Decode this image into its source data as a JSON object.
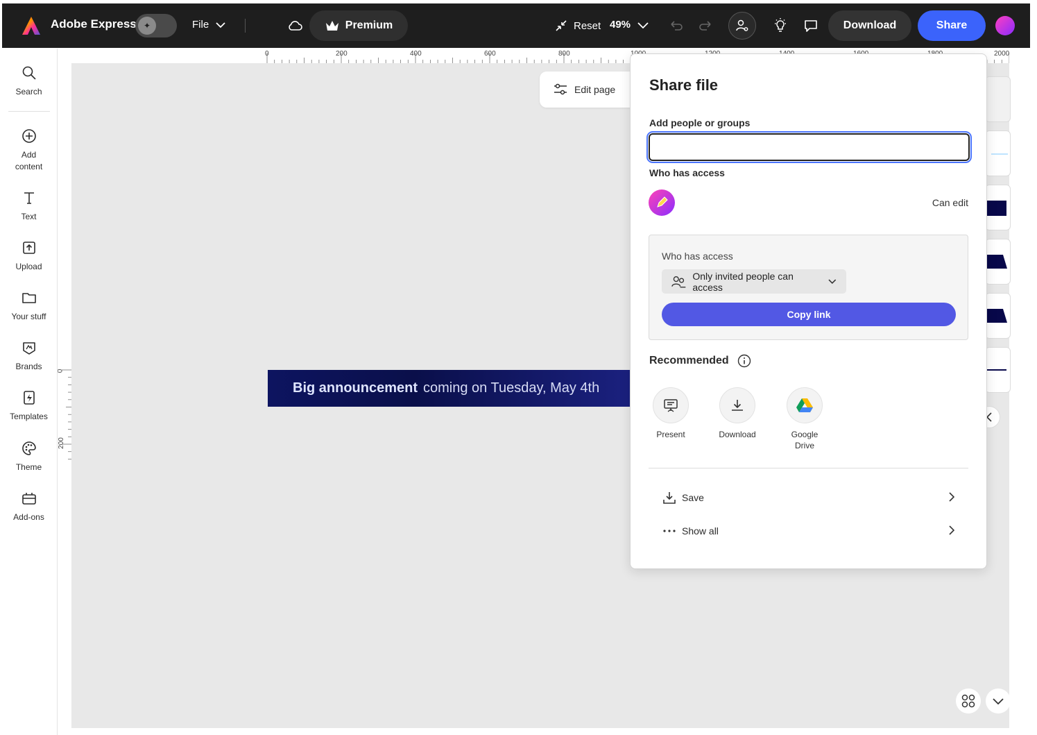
{
  "topbar": {
    "app_title": "Adobe Express",
    "file_label": "File",
    "premium_label": "Premium",
    "reset_label": "Reset",
    "zoom_value": "49%",
    "download_label": "Download",
    "share_label": "Share"
  },
  "sidebar": {
    "items": [
      {
        "label": "Search",
        "icon": "search-icon"
      },
      {
        "label": "Add\ncontent",
        "icon": "plus-circle-icon"
      },
      {
        "label": "Text",
        "icon": "text-icon"
      },
      {
        "label": "Upload",
        "icon": "upload-icon"
      },
      {
        "label": "Your stuff",
        "icon": "folder-icon"
      },
      {
        "label": "Brands",
        "icon": "brand-icon"
      },
      {
        "label": "Templates",
        "icon": "templates-icon"
      },
      {
        "label": "Theme",
        "icon": "palette-icon"
      },
      {
        "label": "Add-ons",
        "icon": "addons-icon"
      }
    ]
  },
  "rulers": {
    "top_ticks": [
      "0",
      "200",
      "400",
      "600",
      "800",
      "1000",
      "1200",
      "1400",
      "1600",
      "1800",
      "2000"
    ],
    "left_ticks": [
      "0",
      "200"
    ]
  },
  "canvas": {
    "edit_page_label": "Edit page",
    "banner_bold": "Big announcement",
    "banner_rest": "coming on Tuesday, May 4th"
  },
  "share_panel": {
    "title": "Share file",
    "add_people_label": "Add people or groups",
    "add_people_value": "",
    "who_has_access_label": "Who has access",
    "user_permission": "Can edit",
    "access_box_label": "Who has access",
    "access_option": "Only invited people can access",
    "copy_link_label": "Copy link",
    "recommended_label": "Recommended",
    "recommended": [
      {
        "label": "Present",
        "icon": "present-icon"
      },
      {
        "label": "Download",
        "icon": "download-icon"
      },
      {
        "label": "Google Drive",
        "icon": "google-drive-icon"
      }
    ],
    "rows": [
      {
        "label": "Save",
        "icon": "save-icon"
      },
      {
        "label": "Show all",
        "icon": "more-icon"
      }
    ]
  },
  "colors": {
    "topbar_bg": "#1e1e1e",
    "share_blue": "#3b63fb",
    "copy_link": "#5258e4",
    "banner_bg": "#0d1460"
  }
}
